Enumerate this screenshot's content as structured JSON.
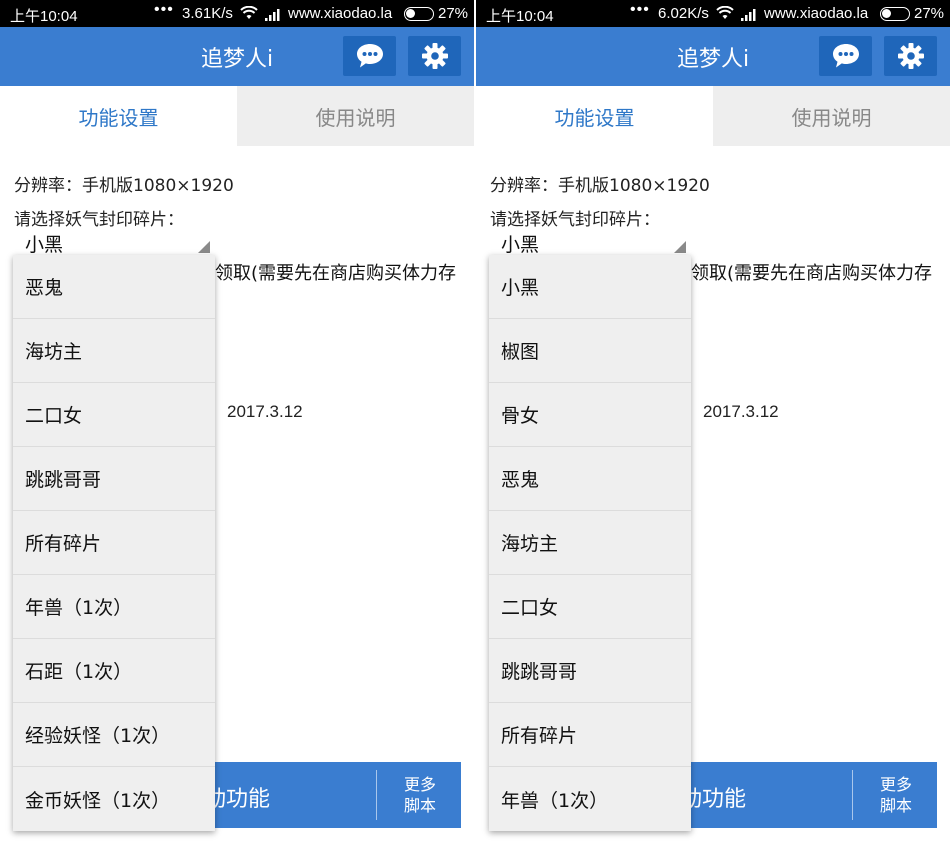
{
  "screens": [
    {
      "status": {
        "time": "上午10:04",
        "speed": "3.61K/s",
        "site": "www.xiaodao.la",
        "battery": "27%"
      },
      "header": {
        "title": "追梦人i"
      },
      "tabs": [
        "功能设置",
        "使用说明"
      ],
      "resolution": "分辨率：手机版1080×1920",
      "prompt": "请选择妖气封印碎片：",
      "selected": "小黑",
      "partial_text": "领取(需要先在商店购买体力存",
      "date": "2017.3.12",
      "bottom": {
        "start": "动功能",
        "more": "更多 脚本"
      },
      "options": [
        "恶鬼",
        "海坊主",
        "二口女",
        "跳跳哥哥",
        "所有碎片",
        "年兽（1次）",
        "石距（1次）",
        "经验妖怪（1次）",
        "金币妖怪（1次）"
      ]
    },
    {
      "status": {
        "time": "上午10:04",
        "speed": "6.02K/s",
        "site": "www.xiaodao.la",
        "battery": "27%"
      },
      "header": {
        "title": "追梦人i"
      },
      "tabs": [
        "功能设置",
        "使用说明"
      ],
      "resolution": "分辨率：手机版1080×1920",
      "prompt": "请选择妖气封印碎片：",
      "selected": "小黑",
      "partial_text": "领取(需要先在商店购买体力存",
      "date": "2017.3.12",
      "bottom": {
        "start": "动功能",
        "more": "更多 脚本"
      },
      "options": [
        "小黑",
        "椒图",
        "骨女",
        "恶鬼",
        "海坊主",
        "二口女",
        "跳跳哥哥",
        "所有碎片",
        "年兽（1次）"
      ]
    }
  ]
}
